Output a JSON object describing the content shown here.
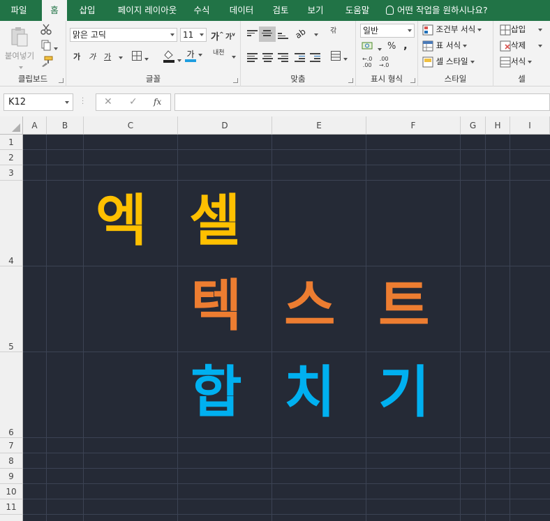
{
  "tabs": [
    "파일",
    "홈",
    "삽입",
    "페이지 레이아웃",
    "수식",
    "데이터",
    "검토",
    "보기",
    "도움말"
  ],
  "tell_me": "어떤 작업을 원하시나요?",
  "clipboard": {
    "paste": "붙여넣기",
    "label": "클립보드"
  },
  "font": {
    "name": "맑은 고딕",
    "size": "11",
    "grow": "가",
    "shrink": "가",
    "bold": "가",
    "italic": "가",
    "underline": "가",
    "color_letter": "가",
    "phonetic": "내천",
    "label": "글꼴"
  },
  "alignment": {
    "label": "맞춤",
    "wrap": "갂"
  },
  "number": {
    "format": "일반",
    "label": "표시 형식",
    "percent": "%",
    "comma": ",",
    "inc_dec": "←.0\n.00",
    "dec_dec": ".00\n→.0"
  },
  "styles": {
    "conditional": "조건부 서식",
    "table": "표 서식",
    "cell": "셀 스타일",
    "label": "스타일"
  },
  "cells": {
    "insert": "삽입",
    "delete": "삭제",
    "format": "서식",
    "label": "셀"
  },
  "formula_bar": {
    "name_box": "K12",
    "cancel": "✕",
    "enter": "✓",
    "fx": "fx",
    "value": ""
  },
  "columns": [
    "A",
    "B",
    "C",
    "D",
    "E",
    "F",
    "G",
    "H",
    "I"
  ],
  "rows": [
    "1",
    "2",
    "3",
    "4",
    "5",
    "6",
    "7",
    "8",
    "9",
    "10",
    "11"
  ],
  "cell_text": {
    "row4_c": "엑",
    "row4_d": "셀",
    "row5_d": "텍",
    "row5_e": "스",
    "row5_f": "트",
    "row6_d": "합",
    "row6_e": "치",
    "row6_f": "기"
  },
  "colors": {
    "ribbon": "#217346",
    "sheet_bg": "#252a36",
    "yellow": "#ffc000",
    "orange": "#ed7d31",
    "blue": "#00b0f0"
  }
}
